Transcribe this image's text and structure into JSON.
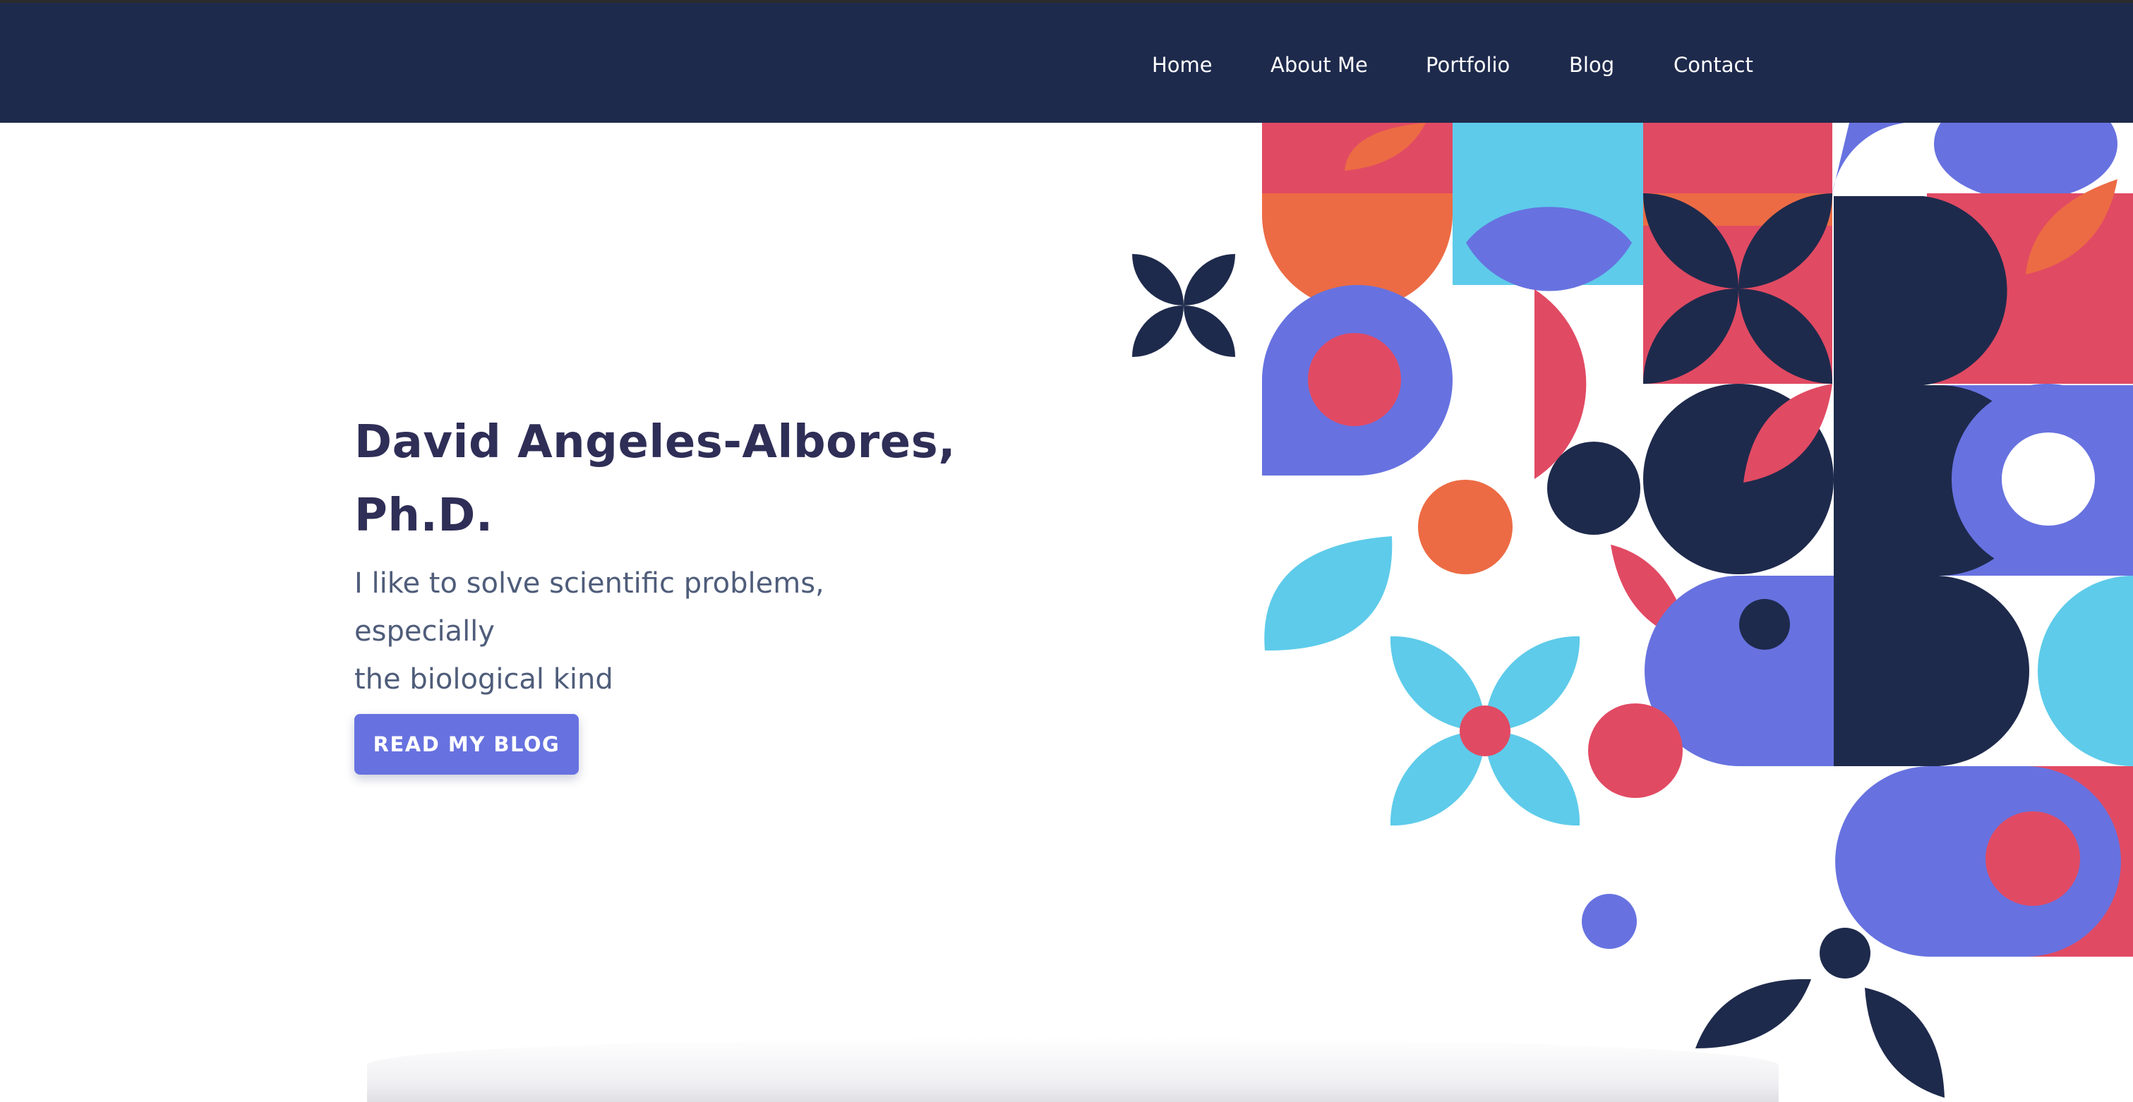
{
  "nav": {
    "items": [
      {
        "label": "Home"
      },
      {
        "label": "About Me"
      },
      {
        "label": "Portfolio"
      },
      {
        "label": "Blog"
      },
      {
        "label": "Contact"
      }
    ]
  },
  "hero": {
    "title_line1": "David Angeles-Albores,",
    "title_line2": "Ph.D.",
    "subtitle_line1": "I like to solve scientific problems, especially",
    "subtitle_line2": "the biological kind",
    "cta_label": "READ MY BLOG"
  },
  "colors": {
    "navy": "#1e2a4c",
    "red": "#e14a63",
    "orange": "#ec6b44",
    "sky": "#5ecbea",
    "periwinkle": "#6772e0",
    "title": "#2e2e57",
    "subtitle": "#4f5d7a"
  }
}
